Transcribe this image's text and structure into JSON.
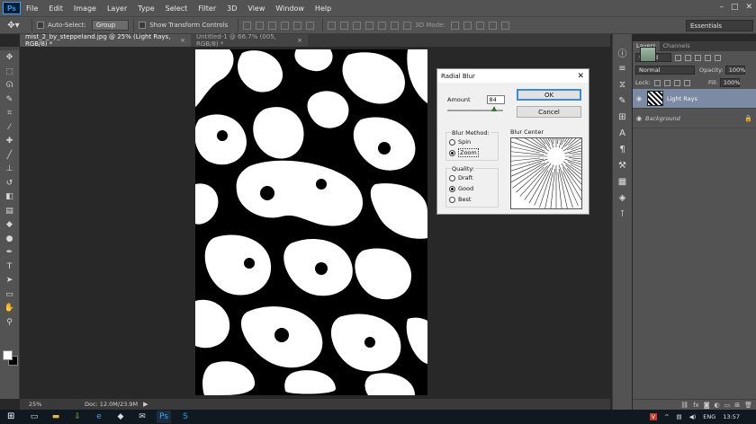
{
  "app": {
    "logo": "Ps",
    "menu": [
      "File",
      "Edit",
      "Image",
      "Layer",
      "Type",
      "Select",
      "Filter",
      "3D",
      "View",
      "Window",
      "Help"
    ],
    "window_controls": [
      "–",
      "□",
      "✕"
    ]
  },
  "options_bar": {
    "auto_select_label": "Auto-Select:",
    "auto_select_value": "Group",
    "show_transform_label": "Show Transform Controls",
    "threed_mode_label": "3D Mode:",
    "workspace": "Essentials"
  },
  "tabs": [
    {
      "title": "mist_2_by_steppeland.jpg @ 25% (Light Rays, RGB/8) *",
      "close": "×"
    },
    {
      "title": "Untitled-1 @ 66.7% (005, RGB/8) *",
      "close": "×"
    }
  ],
  "status": {
    "zoom": "25%",
    "doc": "Doc: 12.0M/23.9M",
    "arrow": "▶"
  },
  "layers_panel": {
    "tabs": [
      "Layers",
      "Channels"
    ],
    "kind_label": "Kind",
    "blend_mode": "Normal",
    "opacity_label": "Opacity:",
    "opacity_value": "100%",
    "lock_label": "Lock:",
    "fill_label": "Fill:",
    "fill_value": "100%",
    "layers": [
      {
        "name": "Light Rays",
        "selected": true
      },
      {
        "name": "Background",
        "selected": false,
        "locked": true
      }
    ]
  },
  "dialog": {
    "title": "Radial Blur",
    "amount_label": "Amount",
    "amount_value": "84",
    "amount_slider": 0.84,
    "ok_label": "OK",
    "cancel_label": "Cancel",
    "blur_method_label": "Blur Method:",
    "blur_methods": [
      "Spin",
      "Zoom"
    ],
    "selected_method": "Zoom",
    "quality_label": "Quality:",
    "qualities": [
      "Draft",
      "Good",
      "Best"
    ],
    "selected_quality": "Good",
    "blur_center_label": "Blur Center"
  },
  "taskbar": {
    "language": "ENG",
    "time": "13:57"
  },
  "colors": {
    "ps_blue": "#31a8ff",
    "panel": "#535353",
    "workspace_bg": "#282828",
    "selected_layer": "#7a8ba3"
  }
}
